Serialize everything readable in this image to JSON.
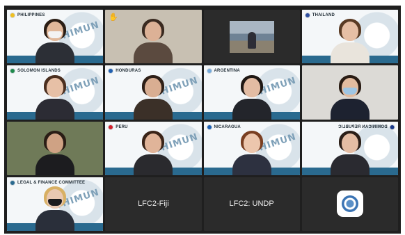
{
  "participants": [
    {
      "label": "PHILIPPINES",
      "flag_color": "#f0c020",
      "mask": true
    },
    {
      "label": "",
      "raised_hand": true
    },
    {
      "label": ""
    },
    {
      "label": "THAILAND",
      "flag_color": "#2f4fa1"
    },
    {
      "label": "SOLOMON ISLANDS",
      "flag_color": "#1f8a4c"
    },
    {
      "label": "HONDURAS",
      "flag_color": "#1f5fb0"
    },
    {
      "label": "ARGENTINA",
      "flag_color": "#75aadb"
    },
    {
      "label": ""
    },
    {
      "label": ""
    },
    {
      "label": "PERU",
      "flag_color": "#d21f2b"
    },
    {
      "label": "NICARAGUA",
      "flag_color": "#1b5fb4"
    },
    {
      "label": "DOMINICAN REPUBLIC",
      "flag_color": "#1a3a8a",
      "mirrored": true
    },
    {
      "label": "LEGAL & FINANCE COMMITTEE",
      "flag_color": "#2a6a8f",
      "active": true
    },
    {
      "name": "LFC2-Fiji"
    },
    {
      "name": "LFC2: UNDP"
    },
    {
      "name": ""
    }
  ],
  "backdrop_text": "THIMUN",
  "raised_hand_icon": "✋"
}
